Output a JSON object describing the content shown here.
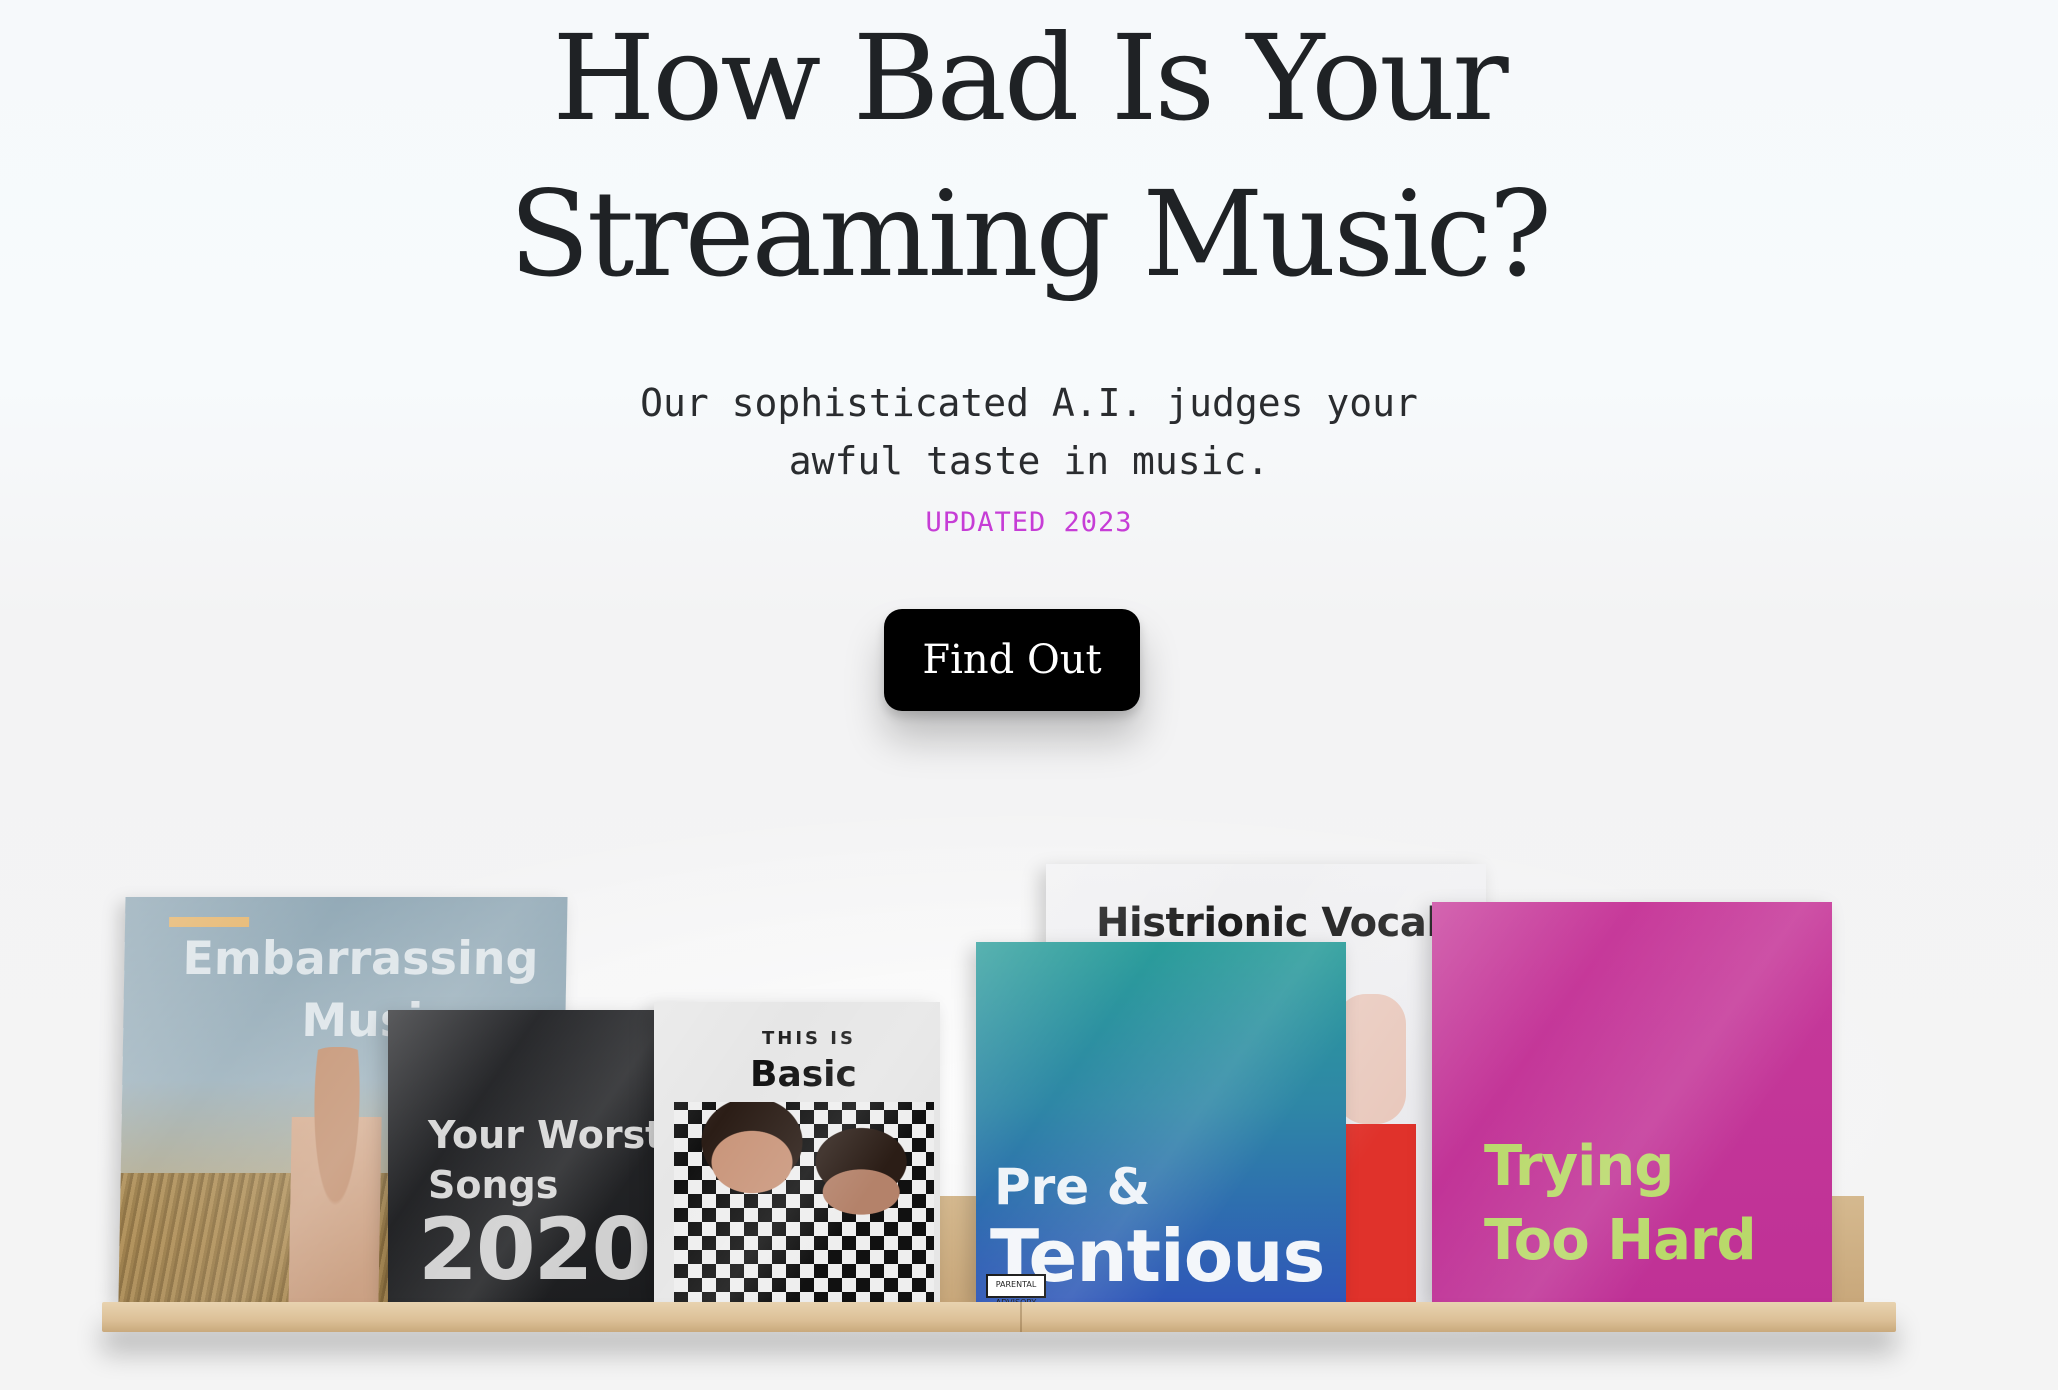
{
  "hero": {
    "title_line1": "How Bad Is Your",
    "title_line2": "Streaming Music?",
    "subtitle_line1": "Our sophisticated A.I. judges your",
    "subtitle_line2": "awful taste in music.",
    "updated": "UPDATED 2023",
    "cta_label": "Find Out"
  },
  "albums": {
    "embarrassing": {
      "line1": "Embarrassing",
      "line2": "Music"
    },
    "worst": {
      "line1": "Your Worst",
      "line2": "Songs",
      "year": "2020"
    },
    "basic": {
      "small": "THIS IS",
      "big": "Basic"
    },
    "histrionic": {
      "title": "Histrionic Vocals"
    },
    "pretentious": {
      "line1": "Pre &",
      "line2": "Tentious",
      "advisory": "PARENTAL ADVISORY"
    },
    "trying": {
      "line1": "Trying",
      "line2": "Too Hard"
    }
  },
  "colors": {
    "accent_updated": "#c63dd6",
    "cta_background": "#000000",
    "cta_text": "#ffffff",
    "title_text": "#1f2225"
  }
}
